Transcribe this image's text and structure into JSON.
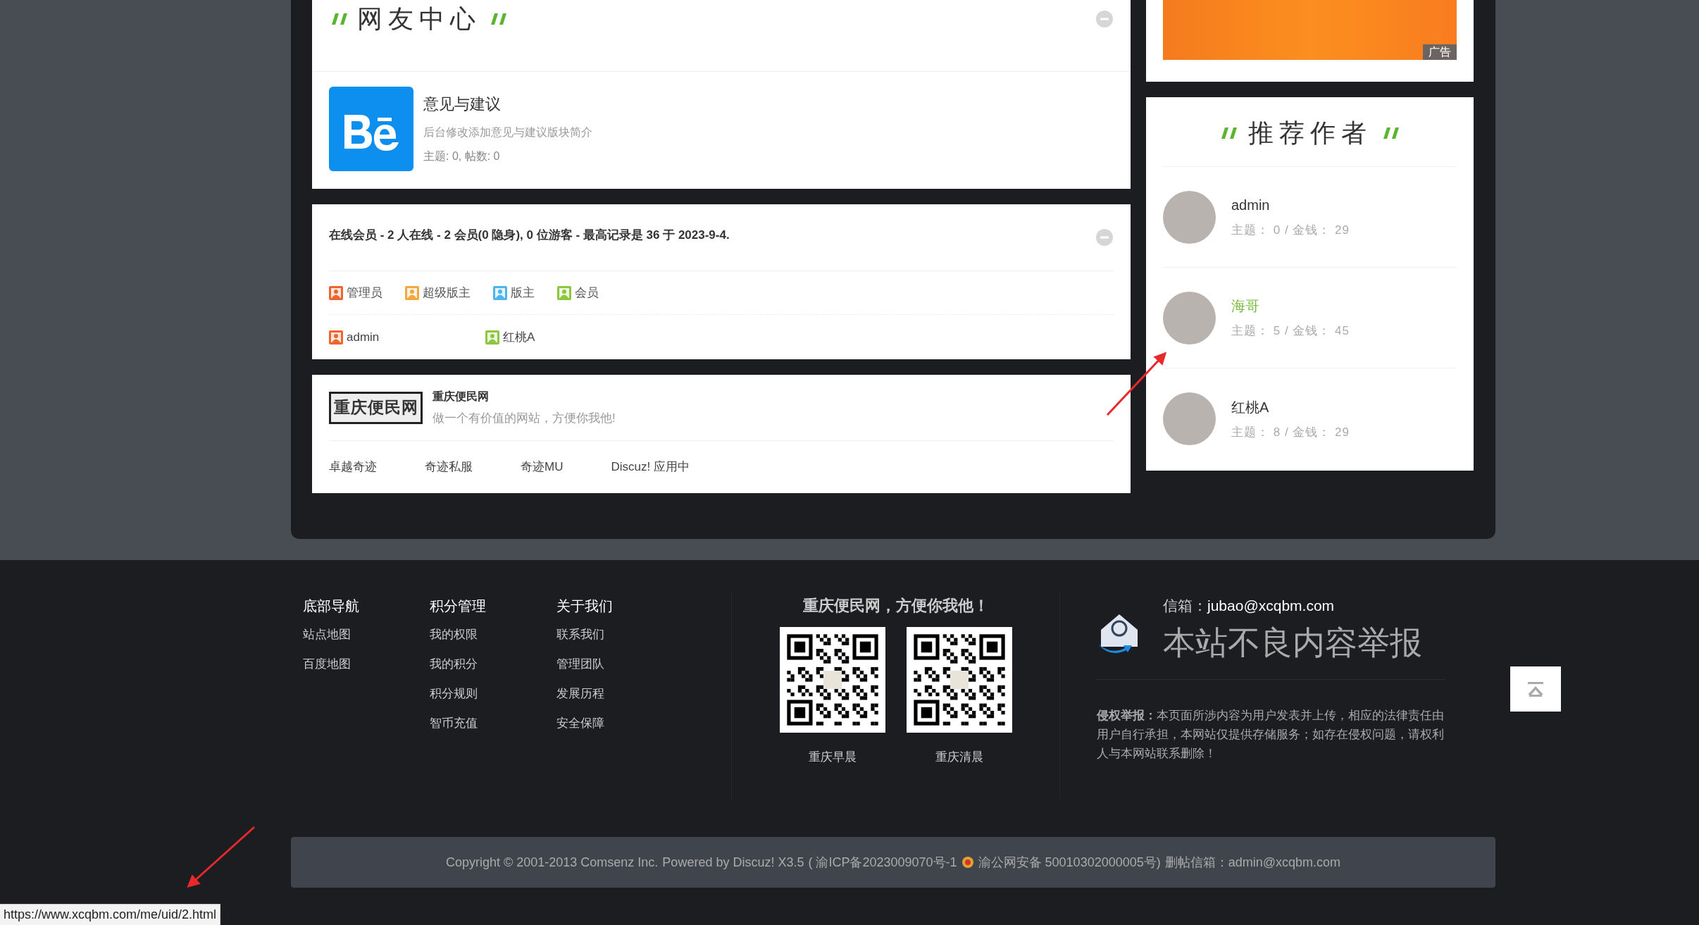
{
  "forum_section": {
    "title": "网友中心",
    "forums": [
      {
        "name": "意见与建议",
        "description": "后台修改添加意见与建议版块简介",
        "stats": "主题: 0, 帖数: 0"
      }
    ]
  },
  "online": {
    "summary": "在线会员 - 2 人在线 - 2 会员(0 隐身), 0 位游客 - 最高记录是 36 于 2023-9-4.",
    "legend": [
      {
        "label": "管理员",
        "color": "#f0642d"
      },
      {
        "label": "超级版主",
        "color": "#f4a73c"
      },
      {
        "label": "版主",
        "color": "#4fb4ea"
      },
      {
        "label": "会员",
        "color": "#8dc63f"
      }
    ],
    "members": [
      {
        "name": "admin",
        "color": "#f0642d"
      },
      {
        "name": "红桃A",
        "color": "#8dc63f"
      }
    ]
  },
  "links": {
    "logo_text": "重庆便民网",
    "site_name": "重庆便民网",
    "site_desc": "做一个有价值的网站，方便你我他!",
    "text_links": [
      "卓越奇迹",
      "奇迹私服",
      "奇迹MU",
      "Discuz! 应用中"
    ]
  },
  "ad": {
    "label": "广告"
  },
  "authors": {
    "title": "推荐作者",
    "items": [
      {
        "name": "admin",
        "stats": "主题： 0 / 金钱： 29",
        "highlighted": false
      },
      {
        "name": "海哥",
        "stats": "主题： 5 / 金钱： 45",
        "highlighted": true
      },
      {
        "name": "红桃A",
        "stats": "主题： 8 / 金钱： 29",
        "highlighted": false
      }
    ]
  },
  "footer": {
    "columns": [
      {
        "title": "底部导航",
        "links": [
          "站点地图",
          "百度地图"
        ]
      },
      {
        "title": "积分管理",
        "links": [
          "我的权限",
          "我的积分",
          "积分规则",
          "智币充值"
        ]
      },
      {
        "title": "关于我们",
        "links": [
          "联系我们",
          "管理团队",
          "发展历程",
          "安全保障"
        ]
      }
    ],
    "slogan": "重庆便民网，方便你我他！",
    "qr_codes": [
      {
        "label": "重庆早晨"
      },
      {
        "label": "重庆清晨"
      }
    ],
    "report": {
      "email_label": "信箱：",
      "email": "jubao@xcqbm.com",
      "title": "本站不良内容举报",
      "notice": "**侵权举报：**本页面所涉内容为用户发表并上传，相应的法律责任由用户自行承担，本网站仅提供存储服务；如存在侵权问题，请权利人与本网站联系删除！"
    }
  },
  "copyright": {
    "text": "Copyright © 2001-2013 Comsenz Inc.",
    "powered": "Powered by Discuz! X3.5",
    "icp": "( 渝ICP备2023009070号-1",
    "police": "渝公网安备 50010302000005号)",
    "contact": "删帖信箱：admin@xcqbm.com"
  },
  "status_bar": {
    "url": "https://www.xcqbm.com/me/uid/2.html"
  }
}
